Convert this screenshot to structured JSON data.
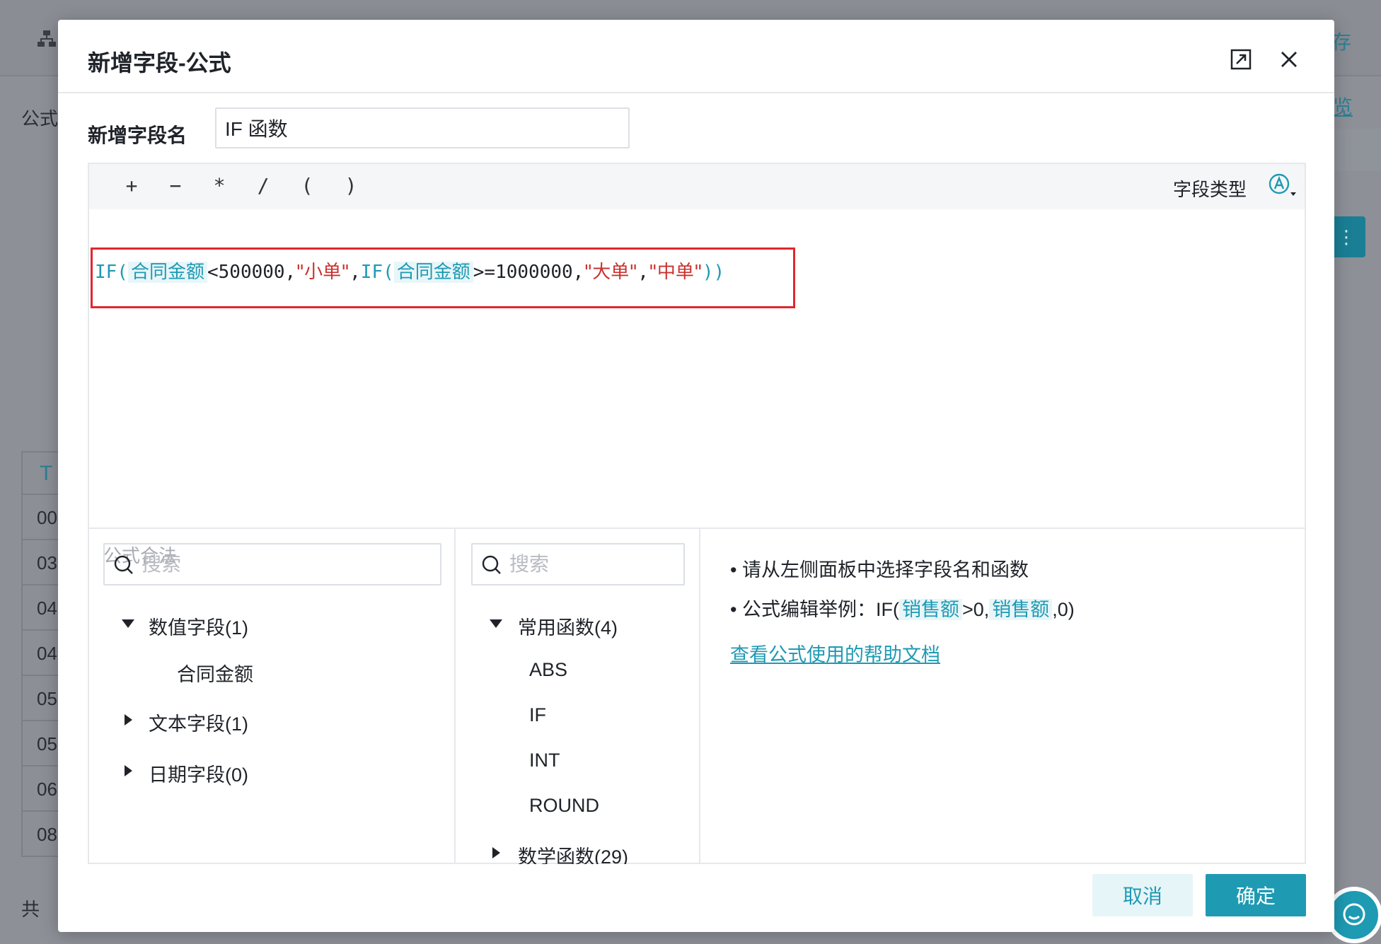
{
  "background": {
    "formula_label": "公式",
    "save_label": "存",
    "preview_label": "览",
    "button_label": "⋮",
    "table_header": "T",
    "table_rows": [
      "00",
      "03",
      "04",
      "04",
      "05",
      "05",
      "06",
      "08"
    ],
    "total_label": "共"
  },
  "dialog": {
    "title": "新增字段-公式",
    "expand_icon": "expand-icon",
    "close_icon": "close-icon"
  },
  "field_name": {
    "label": "新增字段名",
    "value": "IF 函数"
  },
  "toolbar": {
    "operators": [
      "+",
      "−",
      "*",
      "/",
      "(",
      ")"
    ],
    "field_type_label": "字段类型",
    "field_type_icon": "text-type-icon"
  },
  "formula": {
    "fn1": "IF(",
    "field1": "合同金额",
    "op1": "<500000,",
    "str1": "\"小单\"",
    "sep1": ",",
    "fn2": "IF(",
    "field2": "合同金额",
    "op2": ">=1000000,",
    "str2": "\"大单\"",
    "sep2": ",",
    "str3": "\"中单\"",
    "close": "))",
    "validation": "公式合法"
  },
  "field_panel": {
    "search_placeholder": "搜索",
    "groups": [
      {
        "label": "数值字段(1)",
        "expanded": true,
        "items": [
          "合同金额"
        ]
      },
      {
        "label": "文本字段(1)",
        "expanded": false,
        "items": []
      },
      {
        "label": "日期字段(0)",
        "expanded": false,
        "items": []
      }
    ]
  },
  "function_panel": {
    "search_placeholder": "搜索",
    "groups": [
      {
        "label": "常用函数(4)",
        "expanded": true,
        "items": [
          "ABS",
          "IF",
          "INT",
          "ROUND"
        ]
      },
      {
        "label": "数学函数(29)",
        "expanded": false,
        "items": []
      }
    ]
  },
  "hints": {
    "line1": "• 请从左侧面板中选择字段名和函数",
    "line2_prefix": "• 公式编辑举例：IF(",
    "line2_field1": "销售额",
    "line2_mid": ">0,",
    "line2_field2": "销售额",
    "line2_suffix": ",0)",
    "help_link": "查看公式使用的帮助文档"
  },
  "footer": {
    "cancel_label": "取消",
    "ok_label": "确定"
  },
  "colors": {
    "accent": "#1e9ab3",
    "string": "#c9322f",
    "highlight_border": "#e0272e"
  }
}
